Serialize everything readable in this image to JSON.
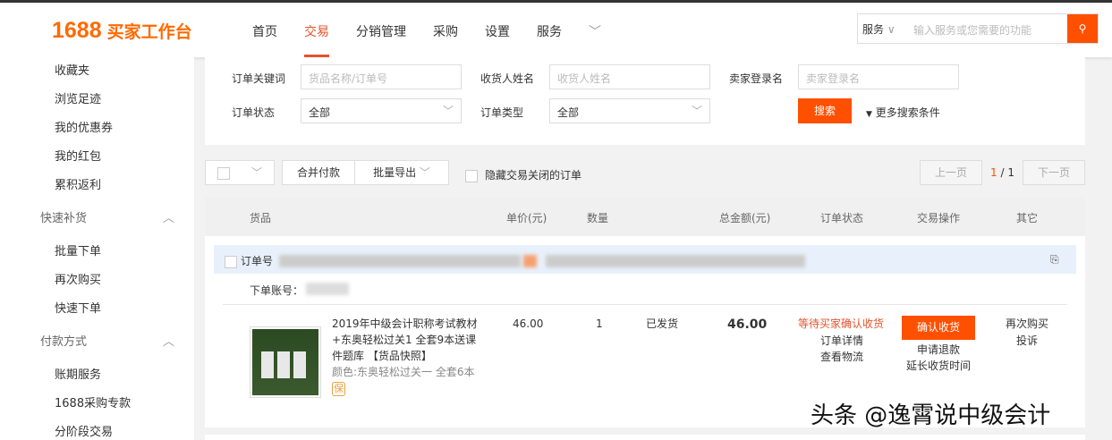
{
  "header": {
    "logo_num": "1688",
    "logo_text": "买家工作台",
    "nav": [
      "首页",
      "交易",
      "分销管理",
      "采购",
      "设置",
      "服务"
    ],
    "search_scope": "服务",
    "search_placeholder": "输入服务或您需要的功能"
  },
  "sidebar": {
    "items_a": [
      "收藏夹",
      "浏览足迹",
      "我的优惠券",
      "我的红包",
      "累积返利"
    ],
    "group1": "快速补货",
    "items_b": [
      "批量下单",
      "再次购买",
      "快速下单"
    ],
    "group2": "付款方式",
    "items_c": [
      "账期服务",
      "1688采购专款",
      "分阶段交易"
    ]
  },
  "filters": {
    "kw_label": "订单关键词",
    "kw_ph": "货品名称/订单号",
    "recv_label": "收货人姓名",
    "recv_ph": "收货人姓名",
    "seller_label": "卖家登录名",
    "seller_ph": "卖家登录名",
    "status_label": "订单状态",
    "status_val": "全部",
    "type_label": "订单类型",
    "type_val": "全部",
    "search_btn": "搜索",
    "more": "更多搜索条件"
  },
  "toolbar": {
    "merge": "合并付款",
    "export": "批量导出",
    "hide_closed": "隐藏交易关闭的订单",
    "prev": "上一页",
    "page_cur": "1",
    "page_sep": "/",
    "page_total": "1",
    "next": "下一页"
  },
  "columns": [
    "货品",
    "单价(元)",
    "数量",
    "总金额(元)",
    "订单状态",
    "交易操作",
    "其它"
  ],
  "order": {
    "no_label": "订单号",
    "account_label": "下单账号：",
    "title": "2019年中级会计职称考试教材+东奥轻松过关1 全套9本送课件题库",
    "snapshot": "【货品快照】",
    "color": "颜色:东奥轻松过关一 全套6本",
    "bao": "保",
    "price": "46.00",
    "qty": "1",
    "ship": "已发货",
    "total": "46.00",
    "status": "等待买家确认收货",
    "detail": "订单详情",
    "logistics": "查看物流",
    "confirm": "确认收货",
    "refund": "申请退款",
    "extend": "延长收货时间",
    "rebuy": "再次购买",
    "complain": "投诉"
  },
  "watermark": "头条 @逸霄说中级会计"
}
